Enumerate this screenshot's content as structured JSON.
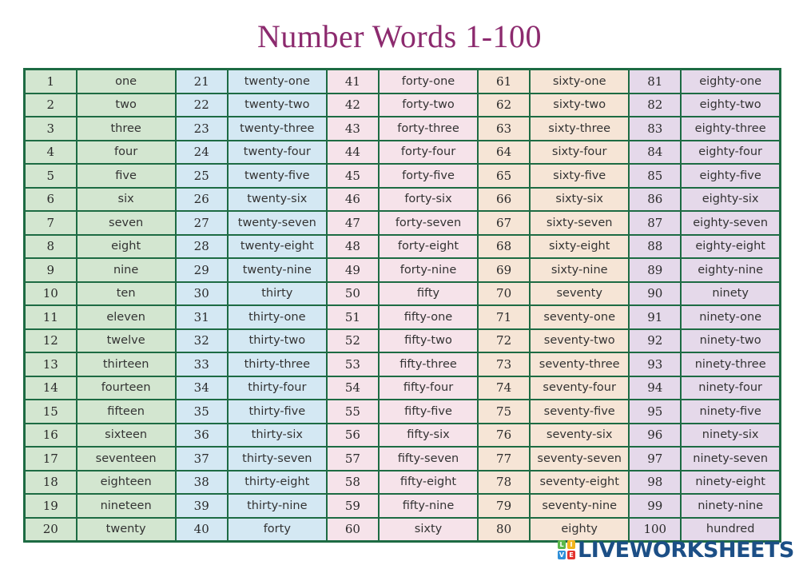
{
  "title": "Number Words 1-100",
  "table": {
    "groups": [
      {
        "color": "#d3e6d0",
        "rows": [
          [
            "1",
            "one"
          ],
          [
            "2",
            "two"
          ],
          [
            "3",
            "three"
          ],
          [
            "4",
            "four"
          ],
          [
            "5",
            "five"
          ],
          [
            "6",
            "six"
          ],
          [
            "7",
            "seven"
          ],
          [
            "8",
            "eight"
          ],
          [
            "9",
            "nine"
          ],
          [
            "10",
            "ten"
          ],
          [
            "11",
            "eleven"
          ],
          [
            "12",
            "twelve"
          ],
          [
            "13",
            "thirteen"
          ],
          [
            "14",
            "fourteen"
          ],
          [
            "15",
            "fifteen"
          ],
          [
            "16",
            "sixteen"
          ],
          [
            "17",
            "seventeen"
          ],
          [
            "18",
            "eighteen"
          ],
          [
            "19",
            "nineteen"
          ],
          [
            "20",
            "twenty"
          ]
        ]
      },
      {
        "color": "#d4e8f3",
        "rows": [
          [
            "21",
            "twenty-one"
          ],
          [
            "22",
            "twenty-two"
          ],
          [
            "23",
            "twenty-three"
          ],
          [
            "24",
            "twenty-four"
          ],
          [
            "25",
            "twenty-five"
          ],
          [
            "26",
            "twenty-six"
          ],
          [
            "27",
            "twenty-seven"
          ],
          [
            "28",
            "twenty-eight"
          ],
          [
            "29",
            "twenty-nine"
          ],
          [
            "30",
            "thirty"
          ],
          [
            "31",
            "thirty-one"
          ],
          [
            "32",
            "thirty-two"
          ],
          [
            "33",
            "thirty-three"
          ],
          [
            "34",
            "thirty-four"
          ],
          [
            "35",
            "thirty-five"
          ],
          [
            "36",
            "thirty-six"
          ],
          [
            "37",
            "thirty-seven"
          ],
          [
            "38",
            "thirty-eight"
          ],
          [
            "39",
            "thirty-nine"
          ],
          [
            "40",
            "forty"
          ]
        ]
      },
      {
        "color": "#f6e3ea",
        "rows": [
          [
            "41",
            "forty-one"
          ],
          [
            "42",
            "forty-two"
          ],
          [
            "43",
            "forty-three"
          ],
          [
            "44",
            "forty-four"
          ],
          [
            "45",
            "forty-five"
          ],
          [
            "46",
            "forty-six"
          ],
          [
            "47",
            "forty-seven"
          ],
          [
            "48",
            "forty-eight"
          ],
          [
            "49",
            "forty-nine"
          ],
          [
            "50",
            "fifty"
          ],
          [
            "51",
            "fifty-one"
          ],
          [
            "52",
            "fifty-two"
          ],
          [
            "53",
            "fifty-three"
          ],
          [
            "54",
            "fifty-four"
          ],
          [
            "55",
            "fifty-five"
          ],
          [
            "56",
            "fifty-six"
          ],
          [
            "57",
            "fifty-seven"
          ],
          [
            "58",
            "fifty-eight"
          ],
          [
            "59",
            "fifty-nine"
          ],
          [
            "60",
            "sixty"
          ]
        ]
      },
      {
        "color": "#f6e5d6",
        "rows": [
          [
            "61",
            "sixty-one"
          ],
          [
            "62",
            "sixty-two"
          ],
          [
            "63",
            "sixty-three"
          ],
          [
            "64",
            "sixty-four"
          ],
          [
            "65",
            "sixty-five"
          ],
          [
            "66",
            "sixty-six"
          ],
          [
            "67",
            "sixty-seven"
          ],
          [
            "68",
            "sixty-eight"
          ],
          [
            "69",
            "sixty-nine"
          ],
          [
            "70",
            "seventy"
          ],
          [
            "71",
            "seventy-one"
          ],
          [
            "72",
            "seventy-two"
          ],
          [
            "73",
            "seventy-three"
          ],
          [
            "74",
            "seventy-four"
          ],
          [
            "75",
            "seventy-five"
          ],
          [
            "76",
            "seventy-six"
          ],
          [
            "77",
            "seventy-seven"
          ],
          [
            "78",
            "seventy-eight"
          ],
          [
            "79",
            "seventy-nine"
          ],
          [
            "80",
            "eighty"
          ]
        ]
      },
      {
        "color": "#e5d9ea",
        "rows": [
          [
            "81",
            "eighty-one"
          ],
          [
            "82",
            "eighty-two"
          ],
          [
            "83",
            "eighty-three"
          ],
          [
            "84",
            "eighty-four"
          ],
          [
            "85",
            "eighty-five"
          ],
          [
            "86",
            "eighty-six"
          ],
          [
            "87",
            "eighty-seven"
          ],
          [
            "88",
            "eighty-eight"
          ],
          [
            "89",
            "eighty-nine"
          ],
          [
            "90",
            "ninety"
          ],
          [
            "91",
            "ninety-one"
          ],
          [
            "92",
            "ninety-two"
          ],
          [
            "93",
            "ninety-three"
          ],
          [
            "94",
            "ninety-four"
          ],
          [
            "95",
            "ninety-five"
          ],
          [
            "96",
            "ninety-six"
          ],
          [
            "97",
            "ninety-seven"
          ],
          [
            "98",
            "ninety-eight"
          ],
          [
            "99",
            "ninety-nine"
          ],
          [
            "100",
            "hundred"
          ]
        ]
      }
    ],
    "border_color": "#1d6b43"
  },
  "title_color": "#8c2a6e",
  "logo": {
    "text": "LIVEWORKSHEETS",
    "squares": [
      {
        "letter": "L",
        "color": "#5bb84a"
      },
      {
        "letter": "I",
        "color": "#f2b51c"
      },
      {
        "letter": "V",
        "color": "#2f8fd8"
      },
      {
        "letter": "E",
        "color": "#e3342f"
      }
    ],
    "text_color": "#1c4f86"
  }
}
